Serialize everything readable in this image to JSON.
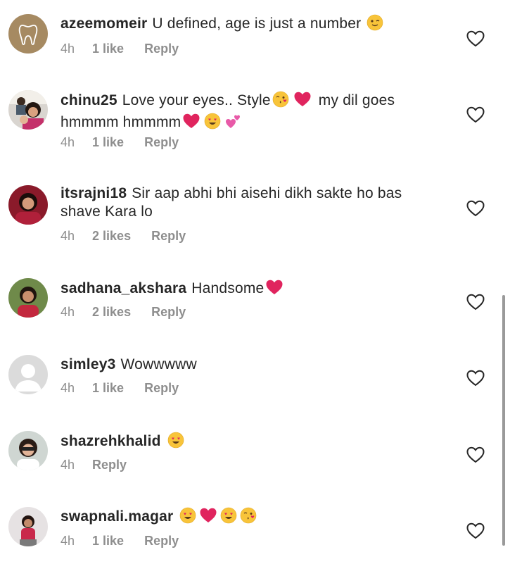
{
  "comments": [
    {
      "username": "azeemomeir",
      "text": "U defined, age is just a number",
      "time": "4h",
      "likes": "1 like",
      "reply": "Reply",
      "emojis": [
        "wink"
      ]
    },
    {
      "username": "chinu25",
      "text": "Love your eyes.. Style",
      "text2": "my dil goes",
      "text3": "hmmmm hmmmm",
      "time": "4h",
      "likes": "1 like",
      "reply": "Reply",
      "emojis": [
        "kiss",
        "red-heart",
        "red-heart",
        "heart-eyes",
        "two-hearts"
      ]
    },
    {
      "username": "itsrajni18",
      "text": "Sir aap abhi bhi aisehi dikh sakte ho bas",
      "text2": "shave Kara lo",
      "time": "4h",
      "likes": "2 likes",
      "reply": "Reply"
    },
    {
      "username": "sadhana_akshara",
      "text": "Handsome",
      "time": "4h",
      "likes": "2 likes",
      "reply": "Reply",
      "emojis": [
        "red-heart"
      ]
    },
    {
      "username": "simley3",
      "text": "Wowwwww",
      "time": "4h",
      "likes": "1 like",
      "reply": "Reply"
    },
    {
      "username": "shazrehkhalid",
      "text": "",
      "time": "4h",
      "likes": "",
      "reply": "Reply",
      "emojis": [
        "heart-eyes"
      ]
    },
    {
      "username": "swapnali.magar",
      "text": "",
      "time": "4h",
      "likes": "1 like",
      "reply": "Reply",
      "emojis": [
        "heart-eyes",
        "red-heart",
        "heart-eyes",
        "kiss"
      ]
    }
  ],
  "icons": {
    "like": "heart-outline-icon"
  },
  "colors": {
    "text": "#262626",
    "meta": "#8e8e8e",
    "heart_red": "#e0245e",
    "emoji_yellow": "#f8c43a"
  }
}
